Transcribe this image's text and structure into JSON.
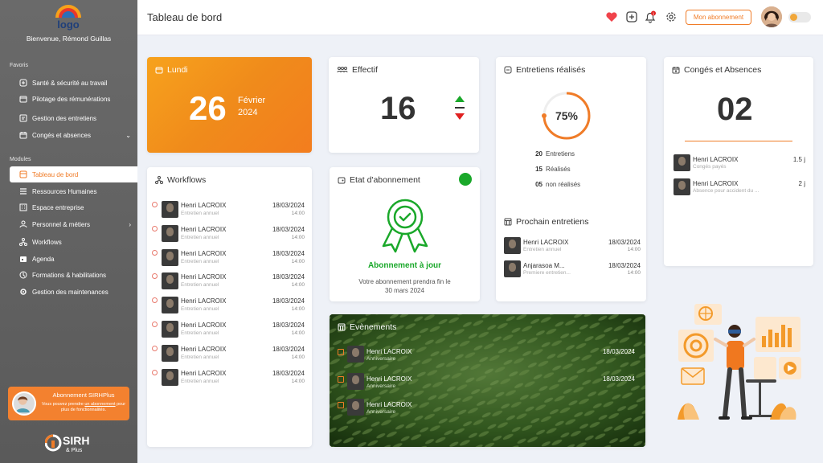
{
  "sidebar": {
    "logo_text": "logo",
    "welcome": "Bienvenue, Rémond Guillas",
    "favoris_label": "Favoris",
    "favoris": [
      {
        "label": "Santé & sécurité au travail",
        "icon": "health-icon"
      },
      {
        "label": "Pilotage des rémunérations",
        "icon": "wallet-icon"
      },
      {
        "label": "Gestion des entretiens",
        "icon": "interview-icon"
      },
      {
        "label": "Congés et absences",
        "icon": "calendar-icon"
      }
    ],
    "modules_label": "Modules",
    "modules": [
      {
        "label": "Tableau de bord",
        "icon": "dashboard-icon"
      },
      {
        "label": "Ressources Humaines",
        "icon": "hr-icon"
      },
      {
        "label": "Espace entreprise",
        "icon": "building-icon"
      },
      {
        "label": "Personnel & métiers",
        "icon": "people-icon"
      },
      {
        "label": "Workflows",
        "icon": "workflow-icon"
      },
      {
        "label": "Agenda",
        "icon": "agenda-icon"
      },
      {
        "label": "Formations & habilitations",
        "icon": "training-icon"
      },
      {
        "label": "Gestion des maintenances",
        "icon": "maintenance-icon"
      }
    ],
    "promo": {
      "title": "Abonnement SIRHPlus",
      "text_pre": "Vous pouvez prendre ",
      "link": "un abonnement",
      "text_post": " pour plus de fonctionnalités."
    },
    "brand_main": "SIRH",
    "brand_sub": "& Plus"
  },
  "topbar": {
    "title": "Tableau de bord",
    "subscription_button": "Mon abonnement",
    "notification_count": "1"
  },
  "colors": {
    "accent": "#f07c28",
    "green": "#1aa82a",
    "red": "#e02020"
  },
  "date_card": {
    "title": "Lundi",
    "day": "26",
    "month": "Février",
    "year": "2024"
  },
  "effectif": {
    "title": "Effectif",
    "value": "16"
  },
  "entretiens": {
    "title": "Entretiens réalisés",
    "percent_label": "75%",
    "percent": 75,
    "stats": [
      {
        "value": "20",
        "label": "Entretiens"
      },
      {
        "value": "15",
        "label": "Réalisés"
      },
      {
        "value": "05",
        "label": "non réalisés"
      }
    ]
  },
  "conges": {
    "title": "Congés et Absences",
    "value": "02",
    "items": [
      {
        "name": "Henri LACROIX",
        "sub": "Congés payés",
        "amount": "1.5 j"
      },
      {
        "name": "Henri LACROIX",
        "sub": "Absence pour accident du ...",
        "amount": "2 j"
      }
    ]
  },
  "workflows": {
    "title": "Workflows",
    "items": [
      {
        "name": "Henri LACROIX",
        "sub": "Entretien annuel",
        "date": "18/03/2024",
        "time": "14:00"
      },
      {
        "name": "Henri LACROIX",
        "sub": "Entretien annuel",
        "date": "18/03/2024",
        "time": "14:00"
      },
      {
        "name": "Henri LACROIX",
        "sub": "Entretien annuel",
        "date": "18/03/2024",
        "time": "14:00"
      },
      {
        "name": "Henri LACROIX",
        "sub": "Entretien annuel",
        "date": "18/03/2024",
        "time": "14:00"
      },
      {
        "name": "Henri LACROIX",
        "sub": "Entretien annuel",
        "date": "18/03/2024",
        "time": "14:00"
      },
      {
        "name": "Henri LACROIX",
        "sub": "Entretien annuel",
        "date": "18/03/2024",
        "time": "14:00"
      },
      {
        "name": "Henri LACROIX",
        "sub": "Entretien annuel",
        "date": "18/03/2024",
        "time": "14:00"
      },
      {
        "name": "Henri LACROIX",
        "sub": "Entretien annuel",
        "date": "18/03/2024",
        "time": "14:00"
      }
    ]
  },
  "abonnement": {
    "title": "Etat d'abonnement",
    "status": "Abonnement à jour",
    "line1": "Votre abonnement prendra fin le",
    "line2": "30 mars 2024"
  },
  "prochain": {
    "title": "Prochain entretiens",
    "items": [
      {
        "name": "Henri LACROIX",
        "sub": "Entretien annuel",
        "date": "18/03/2024",
        "time": "14:00"
      },
      {
        "name": "Anjarasoa M...",
        "sub": "Premiere entretien...",
        "date": "18/03/2024",
        "time": "14:00"
      }
    ]
  },
  "evenements": {
    "title": "Evènements",
    "items": [
      {
        "name": "Henri LACROIX",
        "sub": "Anniversaire",
        "date": "18/03/2024"
      },
      {
        "name": "Henri LACROIX",
        "sub": "Anniversaire",
        "date": "18/03/2024"
      },
      {
        "name": "Henri LACROIX",
        "sub": "Anniversaire",
        "date": "18/03/2024"
      }
    ]
  }
}
